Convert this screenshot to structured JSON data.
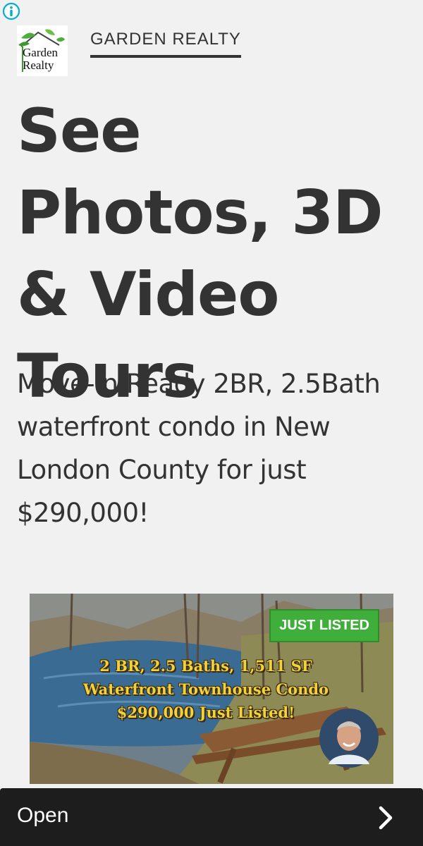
{
  "ad_info": {
    "icon": "info-icon"
  },
  "brand": {
    "logo_text_line1": "Garden",
    "logo_text_line2": "Realty",
    "name": "GARDEN REALTY"
  },
  "headline": "See Photos, 3D & Video Tours",
  "description": "Move-In Ready 2BR, 2.5Bath waterfront condo in New London County for just $290,000!",
  "hero": {
    "badge": "JUST LISTED",
    "overlay_line1": "2 BR, 2.5 Baths, 1,511 SF",
    "overlay_line2": "Waterfront Townhouse Condo",
    "overlay_line3": "$290,000 Just Listed!"
  },
  "cta": {
    "label": "Open",
    "icon": "chevron-right-icon"
  },
  "colors": {
    "accent_green": "#3fae3a",
    "bar": "#1d1d1d",
    "background": "#f1f1f1"
  }
}
